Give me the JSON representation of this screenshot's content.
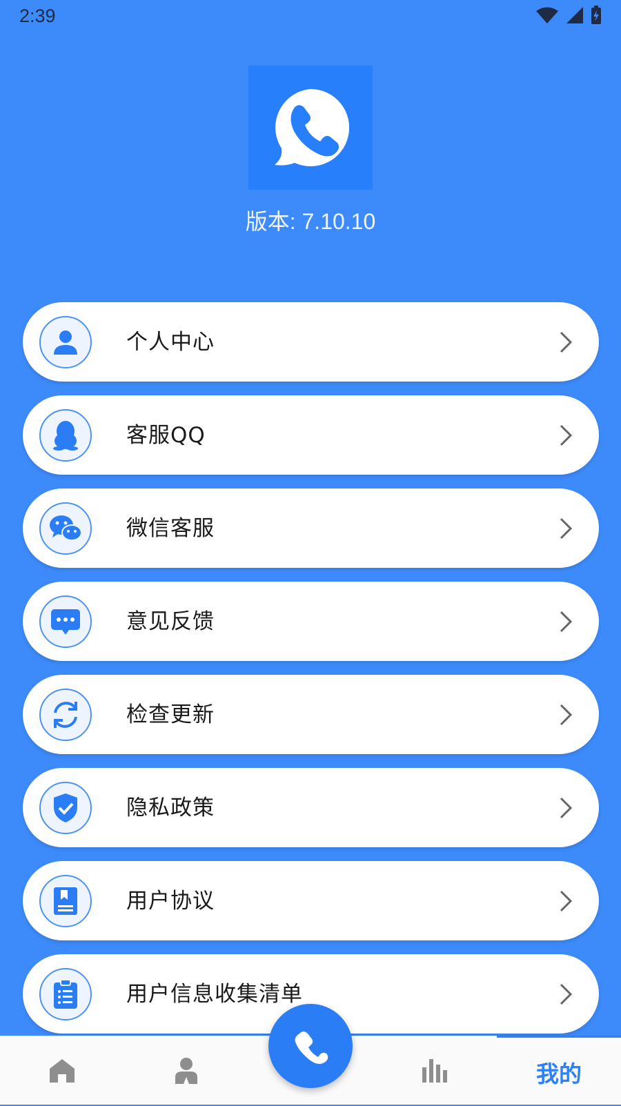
{
  "status_bar": {
    "time": "2:39"
  },
  "app": {
    "version_text": "版本: 7.10.10"
  },
  "menu": {
    "items": [
      {
        "label": "个人中心",
        "icon": "person-icon"
      },
      {
        "label": "客服QQ",
        "icon": "qq-penguin-icon"
      },
      {
        "label": "微信客服",
        "icon": "wechat-icon"
      },
      {
        "label": "意见反馈",
        "icon": "chat-bubble-icon"
      },
      {
        "label": "检查更新",
        "icon": "refresh-icon"
      },
      {
        "label": "隐私政策",
        "icon": "shield-check-icon"
      },
      {
        "label": "用户协议",
        "icon": "document-icon"
      },
      {
        "label": "用户信息收集清单",
        "icon": "clipboard-list-icon"
      }
    ]
  },
  "bottom_nav": {
    "items": [
      {
        "icon": "home-icon"
      },
      {
        "icon": "contact-icon"
      },
      {
        "icon": "phone-icon"
      },
      {
        "icon": "bar-chart-icon"
      },
      {
        "label": "我的"
      }
    ],
    "active_index": 4
  },
  "colors": {
    "background": "#3d8bfb",
    "accent": "#2f7ff5",
    "icon_blue": "#2a7df5"
  }
}
